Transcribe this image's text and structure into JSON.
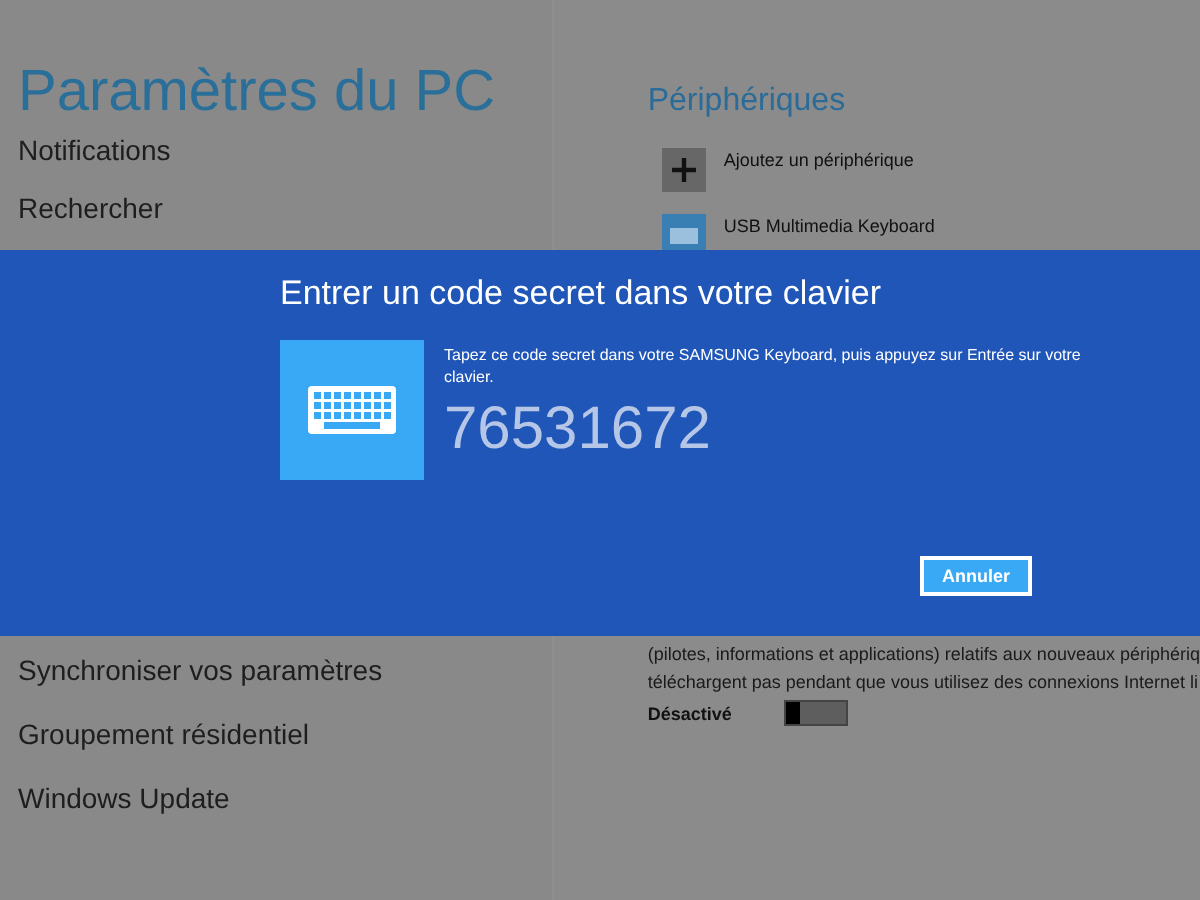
{
  "settings": {
    "title": "Paramètres du PC",
    "menu": [
      {
        "label": "Notifications"
      },
      {
        "label": "Rechercher"
      },
      {
        "label": "Synchroniser vos paramètres"
      },
      {
        "label": "Groupement résidentiel"
      },
      {
        "label": "Windows Update"
      }
    ]
  },
  "devices": {
    "heading": "Périphériques",
    "items": [
      {
        "kind": "add",
        "label": "Ajoutez un périphérique"
      },
      {
        "kind": "keyboard",
        "label": "USB Multimedia Keyboard"
      }
    ],
    "description": [
      "(pilotes, informations et applications) relatifs aux nouveaux périphériq",
      "téléchargent pas pendant que vous utilisez des connexions Internet li"
    ],
    "toggle": {
      "label": "Désactivé",
      "on": false
    }
  },
  "dialog": {
    "title": "Entrer un code secret dans votre clavier",
    "message": "Tapez ce code secret dans votre SAMSUNG Keyboard, puis appuyez sur Entrée sur votre clavier.",
    "code": "76531672",
    "buttons": [
      "Annuler"
    ]
  }
}
